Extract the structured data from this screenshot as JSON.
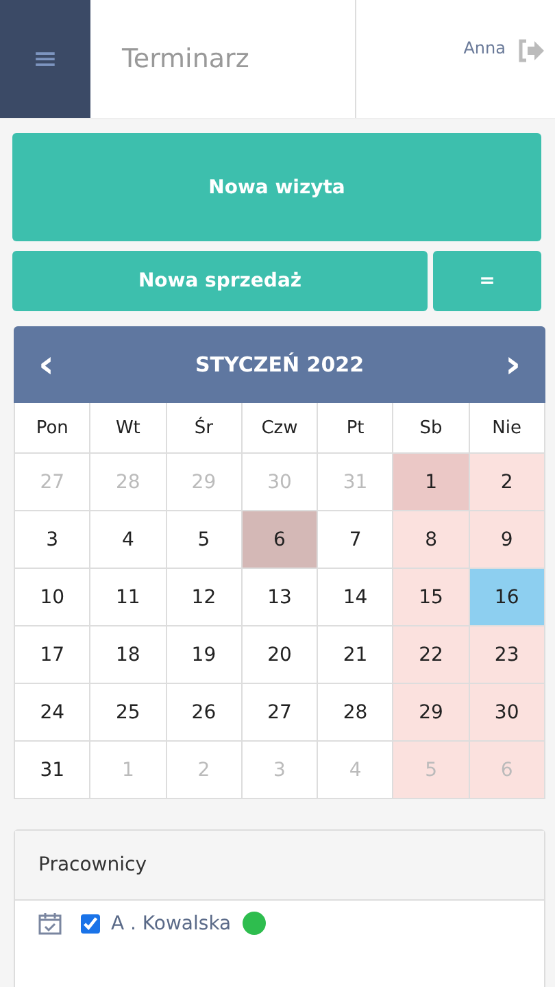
{
  "header": {
    "menu_icon": "≡",
    "title": "Terminarz",
    "user": "Anna"
  },
  "actions": {
    "primary": "Nowa wizyta",
    "secondary": "Nowa sprzedaż",
    "more": "="
  },
  "calendar": {
    "prev": "‹",
    "month": "STYCZEŃ 2022",
    "next": "›",
    "weekdays": [
      "Pon",
      "Wt",
      "Śr",
      "Czw",
      "Pt",
      "Sb",
      "Nie"
    ],
    "days": [
      {
        "label": "27",
        "muted": true,
        "weekend": false,
        "holiday": false,
        "selected": false,
        "today": false
      },
      {
        "label": "28",
        "muted": true,
        "weekend": false,
        "holiday": false,
        "selected": false,
        "today": false
      },
      {
        "label": "29",
        "muted": true,
        "weekend": false,
        "holiday": false,
        "selected": false,
        "today": false
      },
      {
        "label": "30",
        "muted": true,
        "weekend": false,
        "holiday": false,
        "selected": false,
        "today": false
      },
      {
        "label": "31",
        "muted": true,
        "weekend": false,
        "holiday": false,
        "selected": false,
        "today": false
      },
      {
        "label": "1",
        "muted": false,
        "weekend": true,
        "holiday": true,
        "selected": false,
        "today": false
      },
      {
        "label": "2",
        "muted": false,
        "weekend": true,
        "holiday": false,
        "selected": false,
        "today": false
      },
      {
        "label": "3",
        "muted": false,
        "weekend": false,
        "holiday": false,
        "selected": false,
        "today": false
      },
      {
        "label": "4",
        "muted": false,
        "weekend": false,
        "holiday": false,
        "selected": false,
        "today": false
      },
      {
        "label": "5",
        "muted": false,
        "weekend": false,
        "holiday": false,
        "selected": false,
        "today": false
      },
      {
        "label": "6",
        "muted": false,
        "weekend": false,
        "holiday": false,
        "selected": true,
        "today": false
      },
      {
        "label": "7",
        "muted": false,
        "weekend": false,
        "holiday": false,
        "selected": false,
        "today": false
      },
      {
        "label": "8",
        "muted": false,
        "weekend": true,
        "holiday": false,
        "selected": false,
        "today": false
      },
      {
        "label": "9",
        "muted": false,
        "weekend": true,
        "holiday": false,
        "selected": false,
        "today": false
      },
      {
        "label": "10",
        "muted": false,
        "weekend": false,
        "holiday": false,
        "selected": false,
        "today": false
      },
      {
        "label": "11",
        "muted": false,
        "weekend": false,
        "holiday": false,
        "selected": false,
        "today": false
      },
      {
        "label": "12",
        "muted": false,
        "weekend": false,
        "holiday": false,
        "selected": false,
        "today": false
      },
      {
        "label": "13",
        "muted": false,
        "weekend": false,
        "holiday": false,
        "selected": false,
        "today": false
      },
      {
        "label": "14",
        "muted": false,
        "weekend": false,
        "holiday": false,
        "selected": false,
        "today": false
      },
      {
        "label": "15",
        "muted": false,
        "weekend": true,
        "holiday": false,
        "selected": false,
        "today": false
      },
      {
        "label": "16",
        "muted": false,
        "weekend": true,
        "holiday": false,
        "selected": false,
        "today": true
      },
      {
        "label": "17",
        "muted": false,
        "weekend": false,
        "holiday": false,
        "selected": false,
        "today": false
      },
      {
        "label": "18",
        "muted": false,
        "weekend": false,
        "holiday": false,
        "selected": false,
        "today": false
      },
      {
        "label": "19",
        "muted": false,
        "weekend": false,
        "holiday": false,
        "selected": false,
        "today": false
      },
      {
        "label": "20",
        "muted": false,
        "weekend": false,
        "holiday": false,
        "selected": false,
        "today": false
      },
      {
        "label": "21",
        "muted": false,
        "weekend": false,
        "holiday": false,
        "selected": false,
        "today": false
      },
      {
        "label": "22",
        "muted": false,
        "weekend": true,
        "holiday": false,
        "selected": false,
        "today": false
      },
      {
        "label": "23",
        "muted": false,
        "weekend": true,
        "holiday": false,
        "selected": false,
        "today": false
      },
      {
        "label": "24",
        "muted": false,
        "weekend": false,
        "holiday": false,
        "selected": false,
        "today": false
      },
      {
        "label": "25",
        "muted": false,
        "weekend": false,
        "holiday": false,
        "selected": false,
        "today": false
      },
      {
        "label": "26",
        "muted": false,
        "weekend": false,
        "holiday": false,
        "selected": false,
        "today": false
      },
      {
        "label": "27",
        "muted": false,
        "weekend": false,
        "holiday": false,
        "selected": false,
        "today": false
      },
      {
        "label": "28",
        "muted": false,
        "weekend": false,
        "holiday": false,
        "selected": false,
        "today": false
      },
      {
        "label": "29",
        "muted": false,
        "weekend": true,
        "holiday": false,
        "selected": false,
        "today": false
      },
      {
        "label": "30",
        "muted": false,
        "weekend": true,
        "holiday": false,
        "selected": false,
        "today": false
      },
      {
        "label": "31",
        "muted": false,
        "weekend": false,
        "holiday": false,
        "selected": false,
        "today": false
      },
      {
        "label": "1",
        "muted": true,
        "weekend": false,
        "holiday": false,
        "selected": false,
        "today": false
      },
      {
        "label": "2",
        "muted": true,
        "weekend": false,
        "holiday": false,
        "selected": false,
        "today": false
      },
      {
        "label": "3",
        "muted": true,
        "weekend": false,
        "holiday": false,
        "selected": false,
        "today": false
      },
      {
        "label": "4",
        "muted": true,
        "weekend": false,
        "holiday": false,
        "selected": false,
        "today": false
      },
      {
        "label": "5",
        "muted": true,
        "weekend": true,
        "holiday": false,
        "selected": false,
        "today": false
      },
      {
        "label": "6",
        "muted": true,
        "weekend": true,
        "holiday": false,
        "selected": false,
        "today": false
      }
    ]
  },
  "staff": {
    "title": "Pracownicy",
    "members": [
      {
        "name": "A . Kowalska",
        "checked": true,
        "color": "#2ebd4e"
      }
    ]
  }
}
